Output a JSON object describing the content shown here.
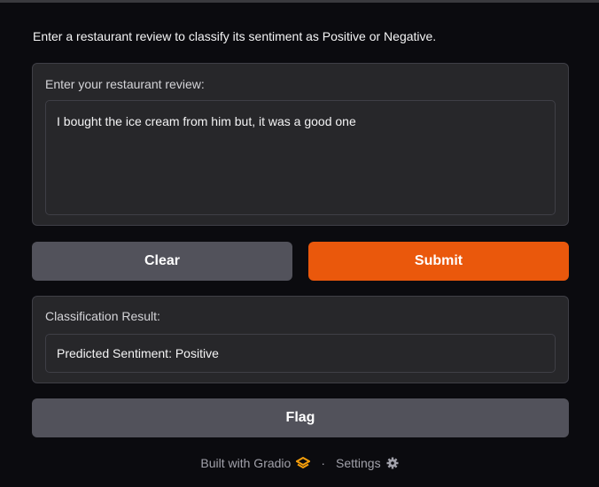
{
  "description": "Enter a restaurant review to classify its sentiment as Positive or Negative.",
  "input": {
    "label": "Enter your restaurant review:",
    "value": "I bought the ice cream from him but, it was a good one"
  },
  "buttons": {
    "clear": "Clear",
    "submit": "Submit",
    "flag": "Flag"
  },
  "output": {
    "label": "Classification Result:",
    "value": "Predicted Sentiment: Positive"
  },
  "footer": {
    "built_with": "Built with Gradio",
    "separator": "·",
    "settings": "Settings"
  },
  "colors": {
    "accent": "#ea580c",
    "secondary": "#52525b"
  }
}
